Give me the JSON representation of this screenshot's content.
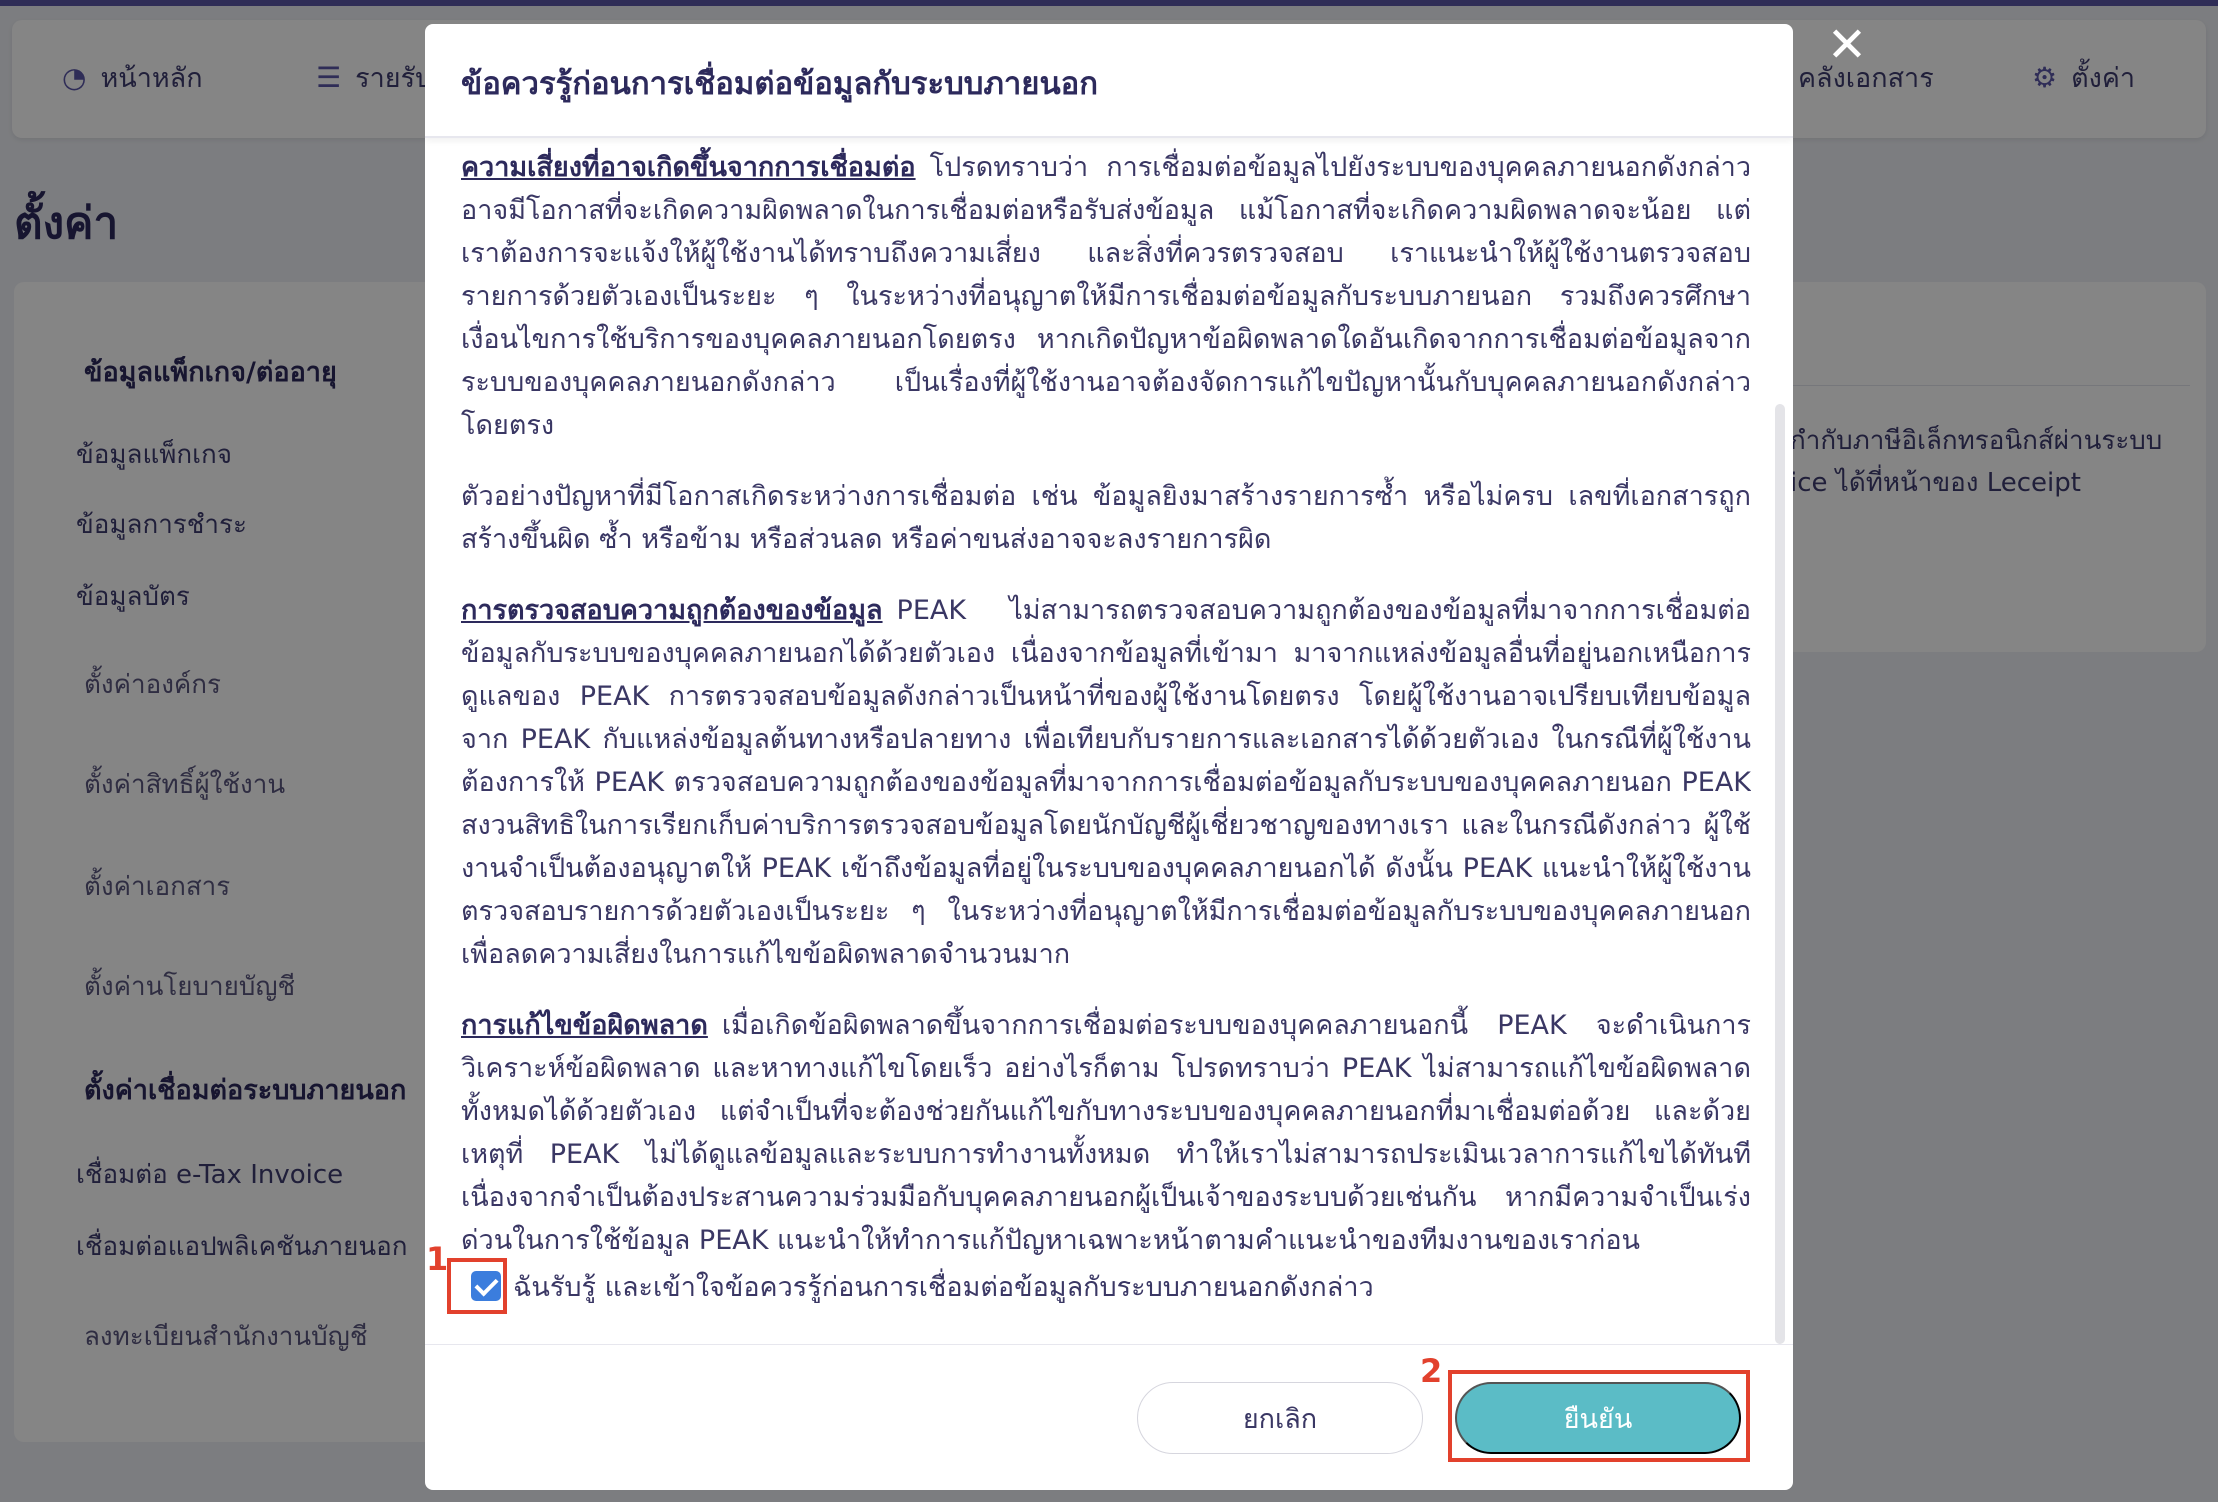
{
  "nav": {
    "home": "หน้าหลัก",
    "income": "รายรับ",
    "documents": "คลังเอกสาร",
    "settings": "ตั้งค่า"
  },
  "page_title": "ตั้งค่า",
  "sidebar": {
    "package_header": "ข้อมูลแพ็กเกจ/ต่ออายุ",
    "package_info": "ข้อมูลแพ็กเกจ",
    "payment_info": "ข้อมูลการชำระ",
    "card_info": "ข้อมูลบัตร",
    "org_settings": "ตั้งค่าองค์กร",
    "user_rights": "ตั้งค่าสิทธิ์ผู้ใช้งาน",
    "doc_settings": "ตั้งค่าเอกสาร",
    "account_policy": "ตั้งค่านโยบายบัญชี",
    "external_header": "ตั้งค่าเชื่อมต่อระบบภายนอก",
    "etax_connect": "เชื่อมต่อ e-Tax Invoice",
    "external_apps": "เชื่อมต่อแอปพลิเคชันภายนอก",
    "register_office": "ลงทะเบียนสำนักงานบัญชี"
  },
  "right_panel": {
    "line1": "กำกับภาษีอิเล็กทรอนิกส์ผ่านระบบ",
    "line2": "ice ได้ที่หน้าของ Leceipt"
  },
  "modal": {
    "title": "ข้อควรรู้ก่อนการเชื่อมต่อข้อมูลกับระบบภายนอก",
    "sections": [
      {
        "heading": "ความเสี่ยงที่อาจเกิดขึ้นจากการเชื่อมต่อ",
        "text": "โปรดทราบว่า การเชื่อมต่อข้อมูลไปยังระบบของบุคคลภายนอกดังกล่าว อาจมีโอกาสที่จะเกิดความผิดพลาดในการเชื่อมต่อหรือรับส่งข้อมูล แม้โอกาสที่จะเกิดความผิดพลาดจะน้อย แต่เราต้องการจะแจ้งให้ผู้ใช้งานได้ทราบถึงความเสี่ยง และสิ่งที่ควรตรวจสอบ เราแนะนำให้ผู้ใช้งานตรวจสอบรายการด้วยตัวเองเป็นระยะ ๆ ในระหว่างที่อนุญาตให้มีการเชื่อมต่อข้อมูลกับระบบภายนอก รวมถึงควรศึกษาเงื่อนไขการใช้บริการของบุคคลภายนอกโดยตรง หากเกิดปัญหาข้อผิดพลาดใดอันเกิดจากการเชื่อมต่อข้อมูลจากระบบของบุคคลภายนอกดังกล่าว เป็นเรื่องที่ผู้ใช้งานอาจต้องจัดการแก้ไขปัญหานั้นกับบุคคลภายนอกดังกล่าวโดยตรง"
      },
      {
        "heading": "",
        "text": "ตัวอย่างปัญหาที่มีโอกาสเกิดระหว่างการเชื่อมต่อ เช่น ข้อมูลยิงมาสร้างรายการซ้ำ หรือไม่ครบ เลขที่เอกสารถูกสร้างขึ้นผิด ซ้ำ หรือข้าม หรือส่วนลด หรือค่าขนส่งอาจจะลงรายการผิด"
      },
      {
        "heading": "การตรวจสอบความถูกต้องของข้อมูล",
        "text": "PEAK ไม่สามารถตรวจสอบความถูกต้องของข้อมูลที่มาจากการเชื่อมต่อข้อมูลกับระบบของบุคคลภายนอกได้ด้วยตัวเอง เนื่องจากข้อมูลที่เข้ามา มาจากแหล่งข้อมูลอื่นที่อยู่นอกเหนือการดูแลของ PEAK การตรวจสอบข้อมูลดังกล่าวเป็นหน้าที่ของผู้ใช้งานโดยตรง โดยผู้ใช้งานอาจเปรียบเทียบข้อมูลจาก PEAK กับแหล่งข้อมูลต้นทางหรือปลายทาง เพื่อเทียบกับรายการและเอกสารได้ด้วยตัวเอง ในกรณีที่ผู้ใช้งานต้องการให้ PEAK ตรวจสอบความถูกต้องของข้อมูลที่มาจากการเชื่อมต่อข้อมูลกับระบบของบุคคลภายนอก PEAK สงวนสิทธิในการเรียกเก็บค่าบริการตรวจสอบข้อมูลโดยนักบัญชีผู้เชี่ยวชาญของทางเรา และในกรณีดังกล่าว ผู้ใช้งานจำเป็นต้องอนุญาตให้ PEAK เข้าถึงข้อมูลที่อยู่ในระบบของบุคคลภายนอกได้ ดังนั้น PEAK แนะนำให้ผู้ใช้งานตรวจสอบรายการด้วยตัวเองเป็นระยะ ๆ ในระหว่างที่อนุญาตให้มีการเชื่อมต่อข้อมูลกับระบบของบุคคลภายนอก เพื่อลดความเสี่ยงในการแก้ไขข้อผิดพลาดจำนวนมาก"
      },
      {
        "heading": "การแก้ไขข้อผิดพลาด",
        "text": "เมื่อเกิดข้อผิดพลาดขึ้นจากการเชื่อมต่อระบบของบุคคลภายนอกนี้ PEAK จะดำเนินการวิเคราะห์ข้อผิดพลาด และหาทางแก้ไขโดยเร็ว อย่างไรก็ตาม โปรดทราบว่า PEAK ไม่สามารถแก้ไขข้อผิดพลาดทั้งหมดได้ด้วยตัวเอง แต่จำเป็นที่จะต้องช่วยกันแก้ไขกับทางระบบของบุคคลภายนอกที่มาเชื่อมต่อด้วย และด้วยเหตุที่ PEAK ไม่ได้ดูแลข้อมูลและระบบการทำงานทั้งหมด ทำให้เราไม่สามารถประเมินเวลาการแก้ไขได้ทันที เนื่องจากจำเป็นต้องประสานความร่วมมือกับบุคคลภายนอกผู้เป็นเจ้าของระบบด้วยเช่นกัน หากมีความจำเป็นเร่งด่วนในการใช้ข้อมูล PEAK แนะนำให้ทำการแก้ปัญหาเฉพาะหน้าตามคำแนะนำของทีมงานของเราก่อน"
      }
    ],
    "acknowledge_label": "ฉันรับรู้ และเข้าใจข้อควรรู้ก่อนการเชื่อมต่อข้อมูลกับระบบภายนอกดังกล่าว",
    "acknowledge_checked": true,
    "cancel_label": "ยกเลิก",
    "confirm_label": "ยืนยัน"
  },
  "annotations": {
    "step1": "1",
    "step2": "2"
  },
  "colors": {
    "accent": "#5b56a8",
    "confirm_button": "#5bbcc6",
    "checkbox": "#3b7ddd",
    "annotation": "#e2412d"
  },
  "icons": [
    "chart-icon",
    "list-icon",
    "gear-icon",
    "close-icon",
    "check-icon"
  ]
}
